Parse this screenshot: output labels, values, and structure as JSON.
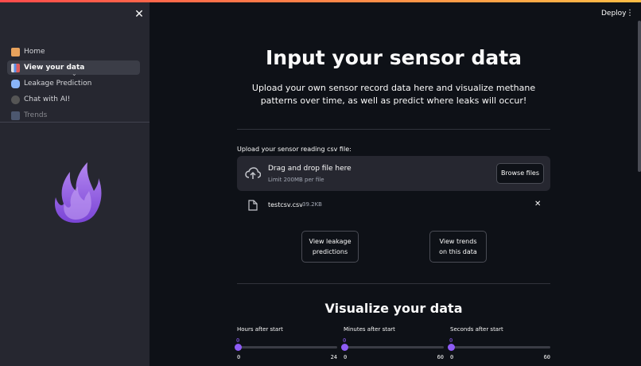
{
  "sidebar": {
    "items": [
      {
        "label": "Home",
        "icon": "house-icon",
        "color": "#e8a25c",
        "active": false
      },
      {
        "label": "View your data",
        "icon": "bar-chart-icon",
        "color": "#5c8fe8",
        "active": true
      },
      {
        "label": "Leakage Prediction",
        "icon": "puzzle-icon",
        "color": "#8ab4f8",
        "active": false
      },
      {
        "label": "Chat with AI!",
        "icon": "chat-bubble-icon",
        "color": "#555555",
        "active": false
      },
      {
        "label": "Trends",
        "icon": "trend-chart-icon",
        "color": "#6b7fa3",
        "active": false
      }
    ],
    "close_glyph": "✕",
    "chevron_glyph": "⌄"
  },
  "header": {
    "deploy_label": "Deploy",
    "menu_glyph": "⋮"
  },
  "main": {
    "title": "Input your sensor data",
    "subtitle": "Upload your own sensor record data here and visualize methane patterns over time, as well as predict where leaks will occur!",
    "upload": {
      "label": "Upload your sensor reading csv file:",
      "drop_text": "Drag and drop file here",
      "limit_text": "Limit 200MB per file",
      "browse_label": "Browse files"
    },
    "file": {
      "name": "testcsv.csv",
      "size": "39.2KB",
      "remove_glyph": "✕"
    },
    "buttons": {
      "predictions": "View leakage predictions",
      "trends": "View trends on this data"
    },
    "section_title": "Visualize your data",
    "sliders": [
      {
        "label": "Hours after start",
        "value": "0",
        "min": "0",
        "max": "24"
      },
      {
        "label": "Minutes after start",
        "value": "0",
        "min": "0",
        "max": "60"
      },
      {
        "label": "Seconds after start",
        "value": "0",
        "min": "0",
        "max": "60"
      }
    ]
  },
  "colors": {
    "accent": "#8e5cf6",
    "background": "#0e1117",
    "sidebar": "#262730"
  }
}
